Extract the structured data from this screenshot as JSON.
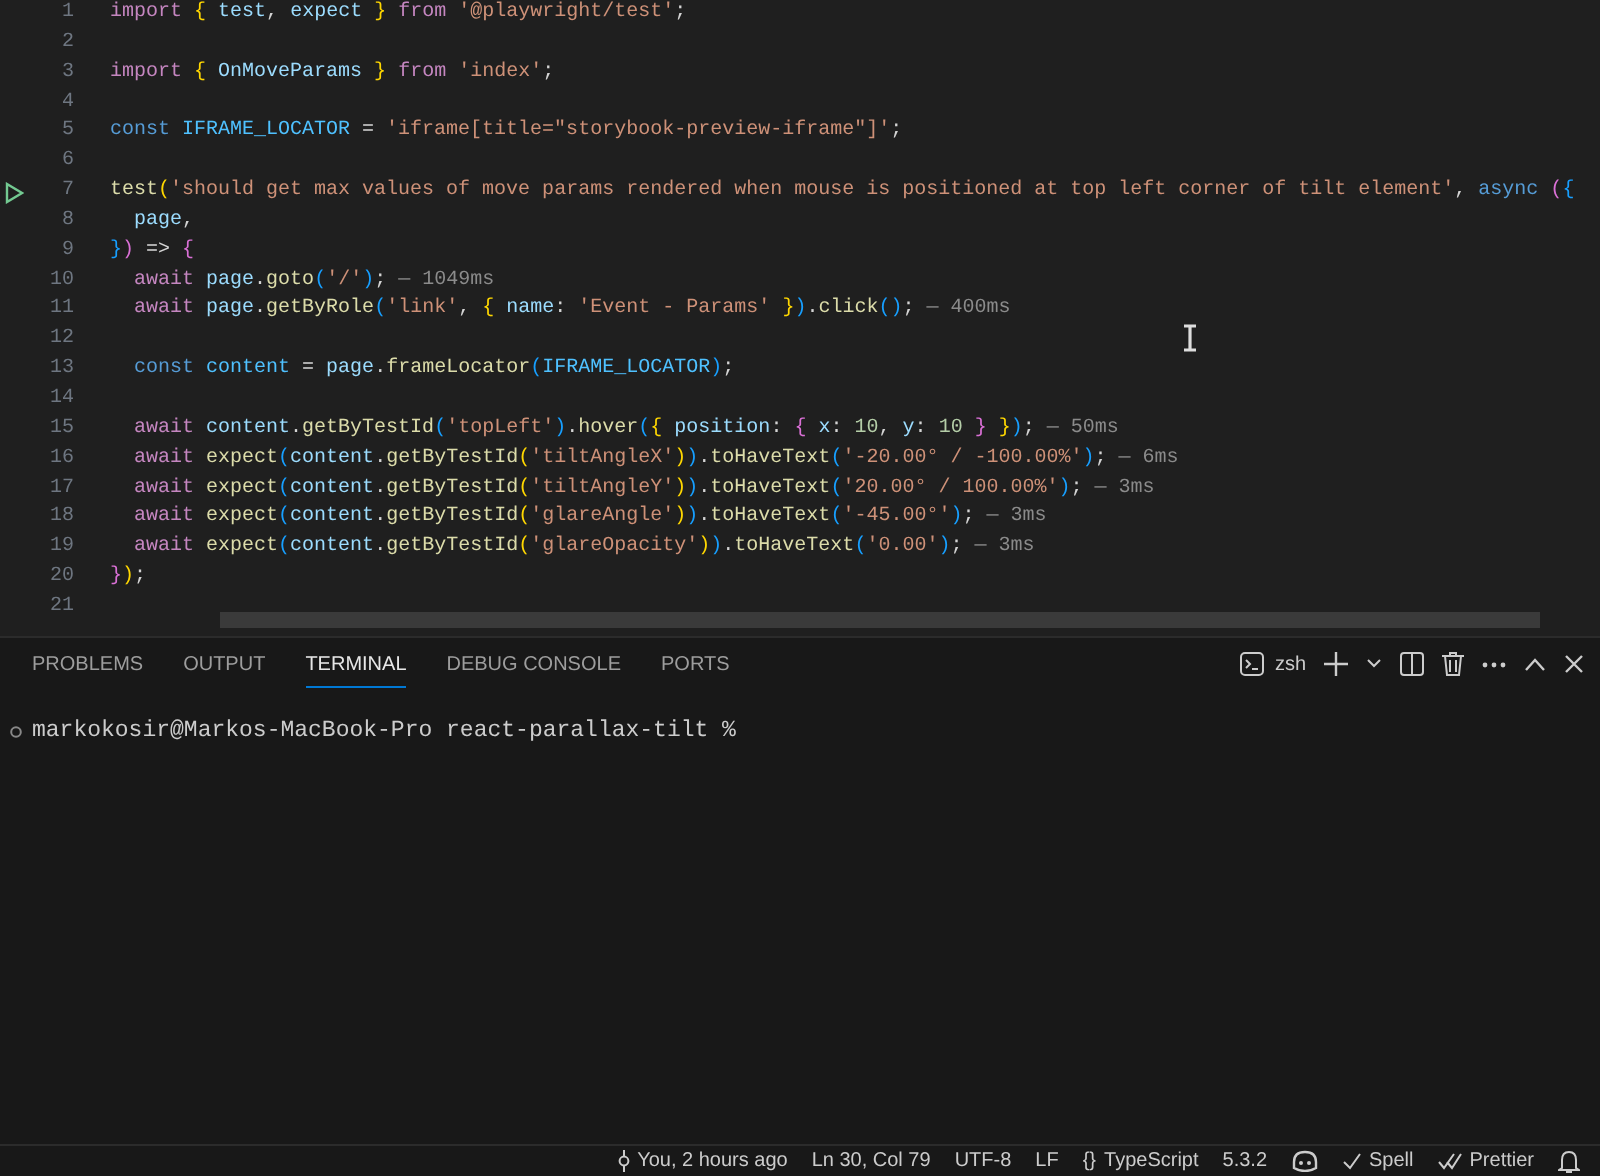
{
  "editor": {
    "lines": [
      {
        "number": "1",
        "run_button": false,
        "tokens": [
          {
            "kind": "kw",
            "text": "import "
          },
          {
            "kind": "b1",
            "text": "{ "
          },
          {
            "kind": "id",
            "text": "test"
          },
          {
            "kind": "t",
            "text": ", "
          },
          {
            "kind": "id",
            "text": "expect "
          },
          {
            "kind": "b1",
            "text": "}"
          },
          {
            "kind": "kw",
            "text": " from "
          },
          {
            "kind": "str",
            "text": "'@playwright/test'"
          },
          {
            "kind": "t",
            "text": ";"
          }
        ]
      },
      {
        "number": "2",
        "run_button": false
      },
      {
        "number": "3",
        "run_button": false,
        "tokens": [
          {
            "kind": "kw",
            "text": "import "
          },
          {
            "kind": "b1",
            "text": "{ "
          },
          {
            "kind": "id",
            "text": "OnMoveParams "
          },
          {
            "kind": "b1",
            "text": "}"
          },
          {
            "kind": "kw",
            "text": " from "
          },
          {
            "kind": "str",
            "text": "'index'"
          },
          {
            "kind": "t",
            "text": ";"
          }
        ]
      },
      {
        "number": "4",
        "run_button": false
      },
      {
        "number": "5",
        "run_button": false,
        "tokens": [
          {
            "kind": "decl",
            "text": "const "
          },
          {
            "kind": "cid",
            "text": "IFRAME_LOCATOR"
          },
          {
            "kind": "t",
            "text": " = "
          },
          {
            "kind": "str",
            "text": "'iframe[title=\"storybook-preview-iframe\"]'"
          },
          {
            "kind": "t",
            "text": ";"
          }
        ]
      },
      {
        "number": "6",
        "run_button": false
      },
      {
        "number": "7",
        "run_button": true,
        "tokens": [
          {
            "kind": "fn",
            "text": "test"
          },
          {
            "kind": "b1",
            "text": "("
          },
          {
            "kind": "str",
            "text": "'should get max values of move params rendered when mouse is positioned at top left corner of tilt element'"
          },
          {
            "kind": "t",
            "text": ", "
          },
          {
            "kind": "decl",
            "text": "async "
          },
          {
            "kind": "b2",
            "text": "("
          },
          {
            "kind": "b3",
            "text": "{"
          }
        ]
      },
      {
        "number": "8",
        "run_button": false,
        "tokens": [
          {
            "kind": "id",
            "text": "  page"
          },
          {
            "kind": "t",
            "text": ","
          }
        ]
      },
      {
        "number": "9",
        "run_button": false,
        "tokens": [
          {
            "kind": "b3",
            "text": "}"
          },
          {
            "kind": "b2",
            "text": ")"
          },
          {
            "kind": "t",
            "text": " => "
          },
          {
            "kind": "b2",
            "text": "{"
          }
        ]
      },
      {
        "number": "10",
        "run_button": false,
        "tokens": [
          {
            "kind": "kw",
            "text": "  await "
          },
          {
            "kind": "id",
            "text": "page"
          },
          {
            "kind": "t",
            "text": "."
          },
          {
            "kind": "fn",
            "text": "goto"
          },
          {
            "kind": "b3",
            "text": "("
          },
          {
            "kind": "str",
            "text": "'/'"
          },
          {
            "kind": "b3",
            "text": ")"
          },
          {
            "kind": "t",
            "text": "; "
          },
          {
            "kind": "hint",
            "text": "— 1049ms"
          }
        ]
      },
      {
        "number": "11",
        "run_button": false,
        "tokens": [
          {
            "kind": "kw",
            "text": "  await "
          },
          {
            "kind": "id",
            "text": "page"
          },
          {
            "kind": "t",
            "text": "."
          },
          {
            "kind": "fn",
            "text": "getByRole"
          },
          {
            "kind": "b3",
            "text": "("
          },
          {
            "kind": "str",
            "text": "'link'"
          },
          {
            "kind": "t",
            "text": ", "
          },
          {
            "kind": "b1",
            "text": "{ "
          },
          {
            "kind": "id",
            "text": "name"
          },
          {
            "kind": "t",
            "text": ": "
          },
          {
            "kind": "str",
            "text": "'Event - Params' "
          },
          {
            "kind": "b1",
            "text": "}"
          },
          {
            "kind": "b3",
            "text": ")"
          },
          {
            "kind": "t",
            "text": "."
          },
          {
            "kind": "fn",
            "text": "click"
          },
          {
            "kind": "b3",
            "text": "()"
          },
          {
            "kind": "t",
            "text": "; "
          },
          {
            "kind": "hint",
            "text": "— 400ms"
          }
        ]
      },
      {
        "number": "12",
        "run_button": false
      },
      {
        "number": "13",
        "run_button": false,
        "tokens": [
          {
            "kind": "decl",
            "text": "  const "
          },
          {
            "kind": "cid",
            "text": "content"
          },
          {
            "kind": "t",
            "text": " = "
          },
          {
            "kind": "id",
            "text": "page"
          },
          {
            "kind": "t",
            "text": "."
          },
          {
            "kind": "fn",
            "text": "frameLocator"
          },
          {
            "kind": "b3",
            "text": "("
          },
          {
            "kind": "cid",
            "text": "IFRAME_LOCATOR"
          },
          {
            "kind": "b3",
            "text": ")"
          },
          {
            "kind": "t",
            "text": ";"
          }
        ]
      },
      {
        "number": "14",
        "run_button": false
      },
      {
        "number": "15",
        "run_button": false,
        "tokens": [
          {
            "kind": "kw",
            "text": "  await "
          },
          {
            "kind": "id",
            "text": "content"
          },
          {
            "kind": "t",
            "text": "."
          },
          {
            "kind": "fn",
            "text": "getByTestId"
          },
          {
            "kind": "b3",
            "text": "("
          },
          {
            "kind": "str",
            "text": "'topLeft'"
          },
          {
            "kind": "b3",
            "text": ")"
          },
          {
            "kind": "t",
            "text": "."
          },
          {
            "kind": "fn",
            "text": "hover"
          },
          {
            "kind": "b3",
            "text": "("
          },
          {
            "kind": "b1",
            "text": "{ "
          },
          {
            "kind": "id",
            "text": "position"
          },
          {
            "kind": "t",
            "text": ": "
          },
          {
            "kind": "b2",
            "text": "{ "
          },
          {
            "kind": "id",
            "text": "x"
          },
          {
            "kind": "t",
            "text": ": "
          },
          {
            "kind": "num",
            "text": "10"
          },
          {
            "kind": "t",
            "text": ", "
          },
          {
            "kind": "id",
            "text": "y"
          },
          {
            "kind": "t",
            "text": ": "
          },
          {
            "kind": "num",
            "text": "10 "
          },
          {
            "kind": "b2",
            "text": "} "
          },
          {
            "kind": "b1",
            "text": "}"
          },
          {
            "kind": "b3",
            "text": ")"
          },
          {
            "kind": "t",
            "text": "; "
          },
          {
            "kind": "hint",
            "text": "— 50ms"
          }
        ]
      },
      {
        "number": "16",
        "run_button": false,
        "tokens": [
          {
            "kind": "kw",
            "text": "  await "
          },
          {
            "kind": "fn",
            "text": "expect"
          },
          {
            "kind": "b3",
            "text": "("
          },
          {
            "kind": "id",
            "text": "content"
          },
          {
            "kind": "t",
            "text": "."
          },
          {
            "kind": "fn",
            "text": "getByTestId"
          },
          {
            "kind": "b1",
            "text": "("
          },
          {
            "kind": "str",
            "text": "'tiltAngleX'"
          },
          {
            "kind": "b1",
            "text": ")"
          },
          {
            "kind": "b3",
            "text": ")"
          },
          {
            "kind": "t",
            "text": "."
          },
          {
            "kind": "fn",
            "text": "toHaveText"
          },
          {
            "kind": "b3",
            "text": "("
          },
          {
            "kind": "str",
            "text": "'-20.00° / -100.00%'"
          },
          {
            "kind": "b3",
            "text": ")"
          },
          {
            "kind": "t",
            "text": "; "
          },
          {
            "kind": "hint",
            "text": "— 6ms"
          }
        ]
      },
      {
        "number": "17",
        "run_button": false,
        "tokens": [
          {
            "kind": "kw",
            "text": "  await "
          },
          {
            "kind": "fn",
            "text": "expect"
          },
          {
            "kind": "b3",
            "text": "("
          },
          {
            "kind": "id",
            "text": "content"
          },
          {
            "kind": "t",
            "text": "."
          },
          {
            "kind": "fn",
            "text": "getByTestId"
          },
          {
            "kind": "b1",
            "text": "("
          },
          {
            "kind": "str",
            "text": "'tiltAngleY'"
          },
          {
            "kind": "b1",
            "text": ")"
          },
          {
            "kind": "b3",
            "text": ")"
          },
          {
            "kind": "t",
            "text": "."
          },
          {
            "kind": "fn",
            "text": "toHaveText"
          },
          {
            "kind": "b3",
            "text": "("
          },
          {
            "kind": "str",
            "text": "'20.00° / 100.00%'"
          },
          {
            "kind": "b3",
            "text": ")"
          },
          {
            "kind": "t",
            "text": "; "
          },
          {
            "kind": "hint",
            "text": "— 3ms"
          }
        ]
      },
      {
        "number": "18",
        "run_button": false,
        "tokens": [
          {
            "kind": "kw",
            "text": "  await "
          },
          {
            "kind": "fn",
            "text": "expect"
          },
          {
            "kind": "b3",
            "text": "("
          },
          {
            "kind": "id",
            "text": "content"
          },
          {
            "kind": "t",
            "text": "."
          },
          {
            "kind": "fn",
            "text": "getByTestId"
          },
          {
            "kind": "b1",
            "text": "("
          },
          {
            "kind": "str",
            "text": "'glareAngle'"
          },
          {
            "kind": "b1",
            "text": ")"
          },
          {
            "kind": "b3",
            "text": ")"
          },
          {
            "kind": "t",
            "text": "."
          },
          {
            "kind": "fn",
            "text": "toHaveText"
          },
          {
            "kind": "b3",
            "text": "("
          },
          {
            "kind": "str",
            "text": "'-45.00°'"
          },
          {
            "kind": "b3",
            "text": ")"
          },
          {
            "kind": "t",
            "text": "; "
          },
          {
            "kind": "hint",
            "text": "— 3ms"
          }
        ]
      },
      {
        "number": "19",
        "run_button": false,
        "tokens": [
          {
            "kind": "kw",
            "text": "  await "
          },
          {
            "kind": "fn",
            "text": "expect"
          },
          {
            "kind": "b3",
            "text": "("
          },
          {
            "kind": "id",
            "text": "content"
          },
          {
            "kind": "t",
            "text": "."
          },
          {
            "kind": "fn",
            "text": "getByTestId"
          },
          {
            "kind": "b1",
            "text": "("
          },
          {
            "kind": "str",
            "text": "'glareOpacity'"
          },
          {
            "kind": "b1",
            "text": ")"
          },
          {
            "kind": "b3",
            "text": ")"
          },
          {
            "kind": "t",
            "text": "."
          },
          {
            "kind": "fn",
            "text": "toHaveText"
          },
          {
            "kind": "b3",
            "text": "("
          },
          {
            "kind": "str",
            "text": "'0.00'"
          },
          {
            "kind": "b3",
            "text": ")"
          },
          {
            "kind": "t",
            "text": "; "
          },
          {
            "kind": "hint",
            "text": "— 3ms"
          }
        ]
      },
      {
        "number": "20",
        "run_button": false,
        "tokens": [
          {
            "kind": "b2",
            "text": "}"
          },
          {
            "kind": "b1",
            "text": ")"
          },
          {
            "kind": "t",
            "text": ";"
          }
        ]
      },
      {
        "number": "21",
        "run_button": false
      }
    ]
  },
  "panel": {
    "tabs": [
      {
        "label": "PROBLEMS",
        "selected": false
      },
      {
        "label": "OUTPUT",
        "selected": false
      },
      {
        "label": "TERMINAL",
        "selected": true
      },
      {
        "label": "DEBUG CONSOLE",
        "selected": false
      },
      {
        "label": "PORTS",
        "selected": false
      }
    ],
    "shell": "zsh",
    "terminal_prompt": "markokosir@Markos-MacBook-Pro react-parallax-tilt %"
  },
  "status_bar": {
    "items": [
      {
        "kind": "blame",
        "text": "You, 2 hours ago"
      },
      {
        "kind": "plain",
        "text": "Ln 30, Col 79"
      },
      {
        "kind": "plain",
        "text": "UTF-8"
      },
      {
        "kind": "plain",
        "text": "LF"
      },
      {
        "kind": "braces",
        "glyph": "{}",
        "text": "TypeScript"
      },
      {
        "kind": "plain",
        "text": "5.3.2"
      },
      {
        "kind": "copilot"
      },
      {
        "kind": "check",
        "text": "Spell"
      },
      {
        "kind": "doublecheck",
        "text": "Prettier"
      },
      {
        "kind": "bell"
      }
    ]
  }
}
